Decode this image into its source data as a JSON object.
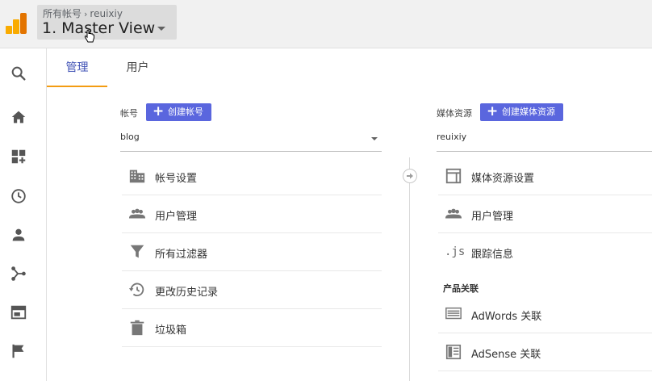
{
  "header": {
    "breadcrumb_root": "所有帐号",
    "breadcrumb_sep": "›",
    "breadcrumb_account": "reuixiy",
    "view_name": "1. Master View"
  },
  "left_nav": {
    "icons": [
      "search-icon",
      "home-icon",
      "dashboard-add-icon",
      "clock-icon",
      "person-icon",
      "share-icon",
      "browser-window-icon",
      "flag-icon"
    ]
  },
  "tabs": [
    {
      "label": "管理",
      "active": true
    },
    {
      "label": "用户",
      "active": false
    }
  ],
  "account_column": {
    "label": "帐号",
    "create_button": "创建帐号",
    "selected": "blog",
    "items": [
      {
        "icon": "building-icon",
        "label": "帐号设置"
      },
      {
        "icon": "people-icon",
        "label": "用户管理"
      },
      {
        "icon": "filter-icon",
        "label": "所有过滤器"
      },
      {
        "icon": "history-icon",
        "label": "更改历史记录"
      },
      {
        "icon": "trash-icon",
        "label": "垃圾箱"
      }
    ]
  },
  "property_column": {
    "label": "媒体资源",
    "create_button": "创建媒体资源",
    "selected": "reuixiy",
    "items": [
      {
        "icon": "window-icon",
        "label": "媒体资源设置"
      },
      {
        "icon": "people-icon",
        "label": "用户管理"
      },
      {
        "icon": "js-icon",
        "label": "跟踪信息",
        "glyph": ".js"
      }
    ],
    "section_title": "产品关联",
    "links": [
      {
        "icon": "adwords-icon",
        "label": "AdWords 关联"
      },
      {
        "icon": "adsense-icon",
        "label": "AdSense 关联"
      }
    ]
  },
  "colors": {
    "accent": "#5a66de",
    "tab_active_text": "#3f51b5",
    "tab_indicator": "#f39c12",
    "logo_light": "#f9ab00",
    "logo_dark": "#e37400"
  }
}
